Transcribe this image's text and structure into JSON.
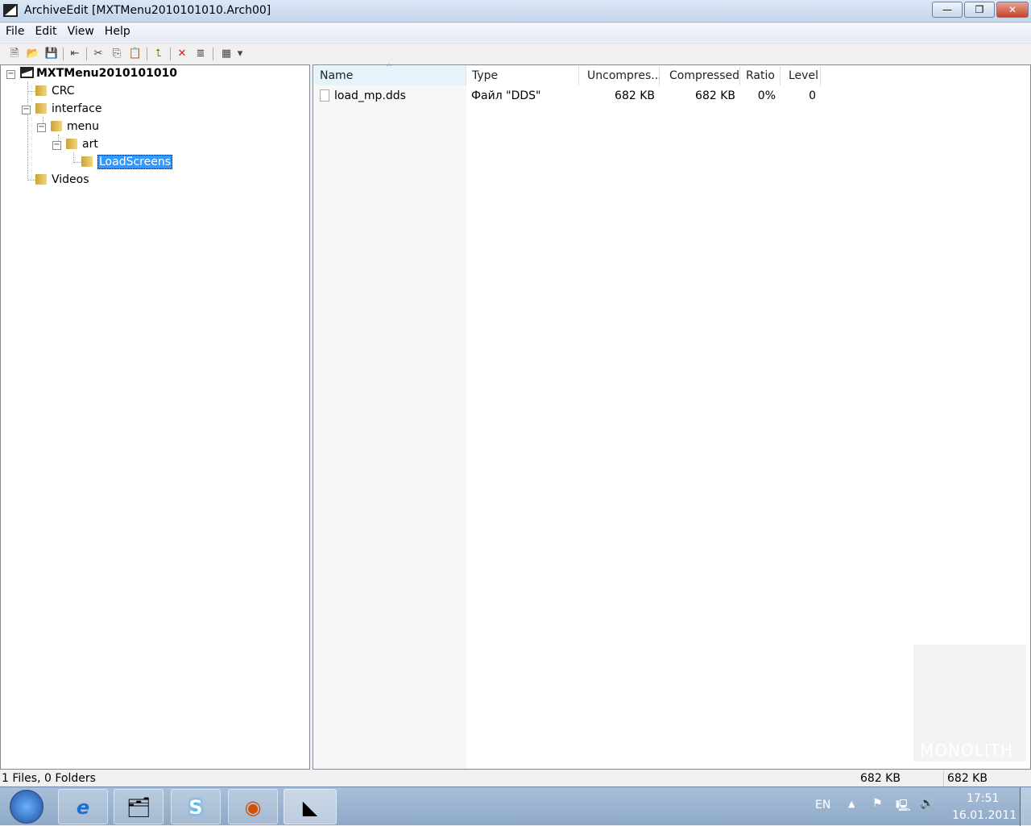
{
  "window": {
    "title": "ArchiveEdit [MXTMenu2010101010.Arch00]",
    "min": "—",
    "max": "❐",
    "close": "✕"
  },
  "menu": [
    "File",
    "Edit",
    "View",
    "Help"
  ],
  "toolbar": [
    {
      "icon": "new-icon",
      "glyph": "🗎"
    },
    {
      "icon": "open-icon",
      "glyph": "📂"
    },
    {
      "icon": "save-icon",
      "glyph": "💾"
    },
    {
      "icon": "extract-icon",
      "glyph": "⇤"
    },
    {
      "icon": "cut-icon",
      "glyph": "✂"
    },
    {
      "icon": "copy-icon",
      "glyph": "⎘"
    },
    {
      "icon": "paste-icon",
      "glyph": "📋"
    },
    {
      "icon": "up-folder-icon",
      "glyph": "⮤"
    },
    {
      "icon": "delete-icon",
      "glyph": "✕"
    },
    {
      "icon": "properties-icon",
      "glyph": "≣"
    },
    {
      "icon": "view-icon",
      "glyph": "▦"
    },
    {
      "icon": "dropdown-icon",
      "glyph": "▾"
    }
  ],
  "tree": {
    "root": "MXTMenu2010101010",
    "items": [
      "CRC",
      "interface",
      "menu",
      "art",
      "LoadScreens",
      "Videos"
    ]
  },
  "list": {
    "columns": [
      "Name",
      "Type",
      "Uncompres...",
      "Compressed",
      "Ratio",
      "Level"
    ],
    "rows": [
      {
        "name": "load_mp.dds",
        "type": "Файл \"DDS\"",
        "uncompressed": "682 KB",
        "compressed": "682 KB",
        "ratio": "0%",
        "level": "0"
      }
    ]
  },
  "watermark": "MONOLITH",
  "status": {
    "left": "1 Files, 0 Folders",
    "uncompressed": "682 KB",
    "compressed": "682 KB"
  },
  "taskbar": {
    "lang": "EN",
    "time": "17:51",
    "date": "16.01.2011",
    "apps": [
      "e",
      "🗂",
      "S",
      "◉",
      "◣"
    ]
  }
}
